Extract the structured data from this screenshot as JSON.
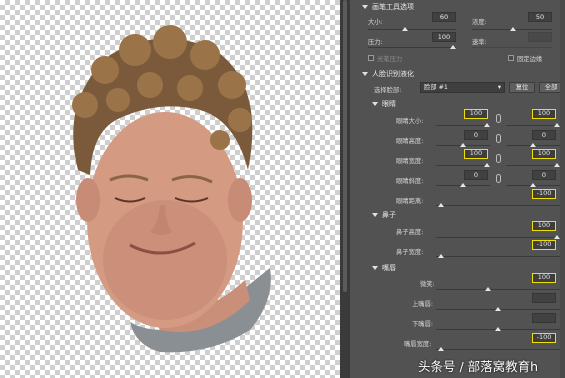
{
  "brush": {
    "title": "画笔工具选项",
    "size_label": "大小:",
    "size_value": "60",
    "density_label": "浓度:",
    "density_value": "50",
    "pressure_label": "压力:",
    "pressure_value": "100",
    "rate_label": "速率:",
    "stylus_label": "光笔压力",
    "pin_edges_label": "固定边缘"
  },
  "face_aware": {
    "title": "人脸识别液化",
    "select_face_label": "选择脸部:",
    "select_face_value": "脸部 #1",
    "reset_label": "复位",
    "all_label": "全部"
  },
  "eyes": {
    "title": "眼睛",
    "size_label": "眼睛大小:",
    "size_left": "100",
    "size_right": "100",
    "height_label": "眼睛高度:",
    "height_left": "0",
    "height_right": "0",
    "width_label": "眼睛宽度:",
    "width_left": "100",
    "width_right": "100",
    "tilt_label": "眼睛斜度:",
    "tilt_left": "0",
    "tilt_right": "0",
    "distance_label": "眼睛距离:",
    "distance_value": "-100"
  },
  "nose": {
    "title": "鼻子",
    "height_label": "鼻子高度:",
    "height_value": "100",
    "width_label": "鼻子宽度:",
    "width_value": "-100"
  },
  "mouth": {
    "title": "嘴唇",
    "smile_label": "微笑:",
    "smile_value": "100",
    "upper_lip_label": "上嘴唇:",
    "lower_lip_label": "下嘴唇:",
    "mouth_width_label": "嘴唇宽度:",
    "mouth_width_value": "-100"
  },
  "watermark": "头条号 / 部落窝教育h"
}
